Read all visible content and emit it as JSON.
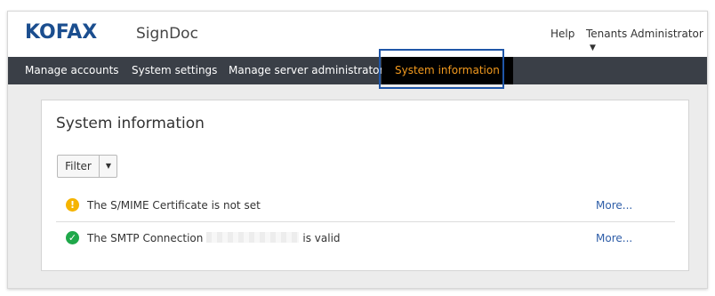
{
  "header": {
    "logo_text": "KOFAX",
    "product_name": "SignDoc",
    "help_label": "Help",
    "user_menu_label": "Tenants Administrator"
  },
  "nav": {
    "items": [
      {
        "label": "Manage accounts"
      },
      {
        "label": "System settings"
      },
      {
        "label": "Manage server administrators"
      },
      {
        "label": "System information"
      }
    ],
    "active_index": 3
  },
  "panel": {
    "title": "System information",
    "filter_label": "Filter",
    "rows": [
      {
        "status": "warning",
        "message": "The S/MIME Certificate is not set",
        "link": "More..."
      },
      {
        "status": "ok",
        "message_before": "The SMTP Connection",
        "message_after": "is valid",
        "link": "More..."
      }
    ]
  },
  "colors": {
    "brand": "#1b4e8f",
    "navbar": "#3a3f47",
    "active_tab_text": "#f39a1e",
    "warning": "#f5b400",
    "success": "#1fa84a",
    "link": "#2f5ea8"
  },
  "icons": {
    "warning": "exclamation-circle-icon",
    "ok": "check-circle-icon",
    "dropdown": "caret-down-icon"
  }
}
